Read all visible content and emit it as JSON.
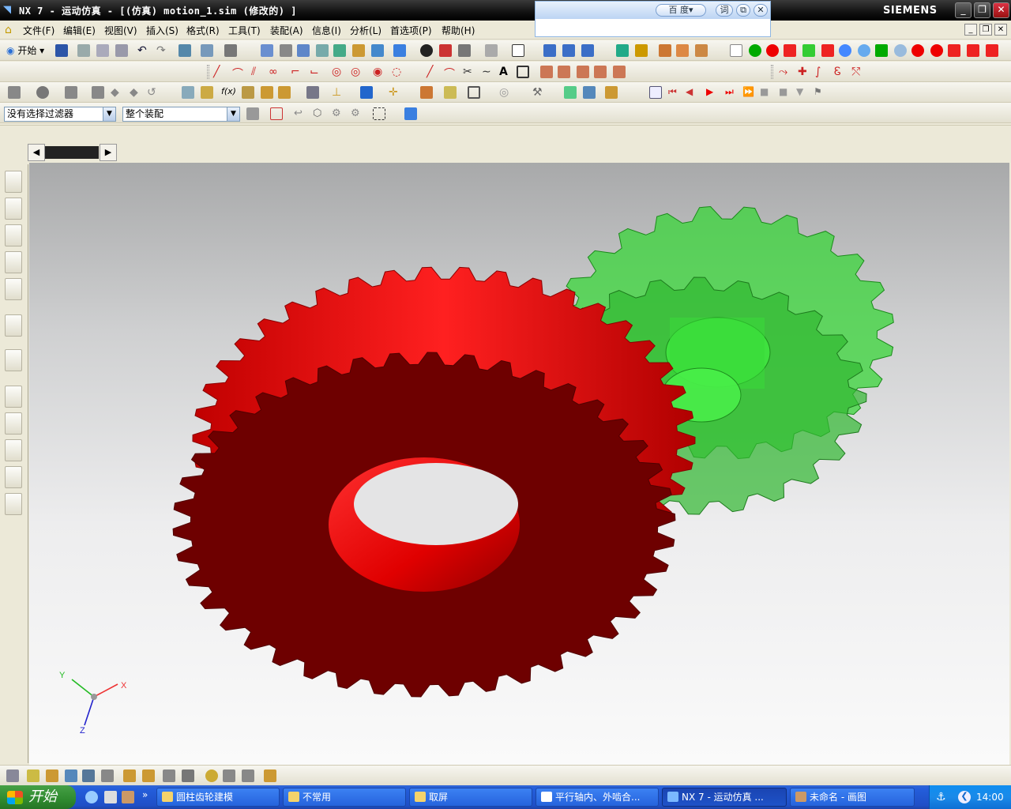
{
  "window": {
    "title": "NX 7 - 运动仿真 - [(仿真) motion_1.sim  (修改的) ]",
    "brand": "SIEMENS"
  },
  "baidu": {
    "label": "百 度▾",
    "dict": "词"
  },
  "menu": [
    "文件(F)",
    "编辑(E)",
    "视图(V)",
    "插入(S)",
    "格式(R)",
    "工具(T)",
    "装配(A)",
    "信息(I)",
    "分析(L)",
    "首选项(P)",
    "帮助(H)"
  ],
  "toolbar": {
    "start_label": "开始",
    "filter_value": "没有选择过滤器",
    "scope_value": "整个装配"
  },
  "axes": {
    "x": "X",
    "y": "Y",
    "z": "Z"
  },
  "colors": {
    "red_gear": "#ff1a1a",
    "red_gear_face": "#6e0000",
    "green_gear": "#2fe02f",
    "accent": "#245edb"
  },
  "taskbar": {
    "start": "开始",
    "items": [
      "圆柱齿轮建模",
      "不常用",
      "取屏",
      "平行轴内、外啮合...",
      "NX 7 - 运动仿真 ...",
      "未命名 - 画图"
    ],
    "clock": "14:00"
  }
}
